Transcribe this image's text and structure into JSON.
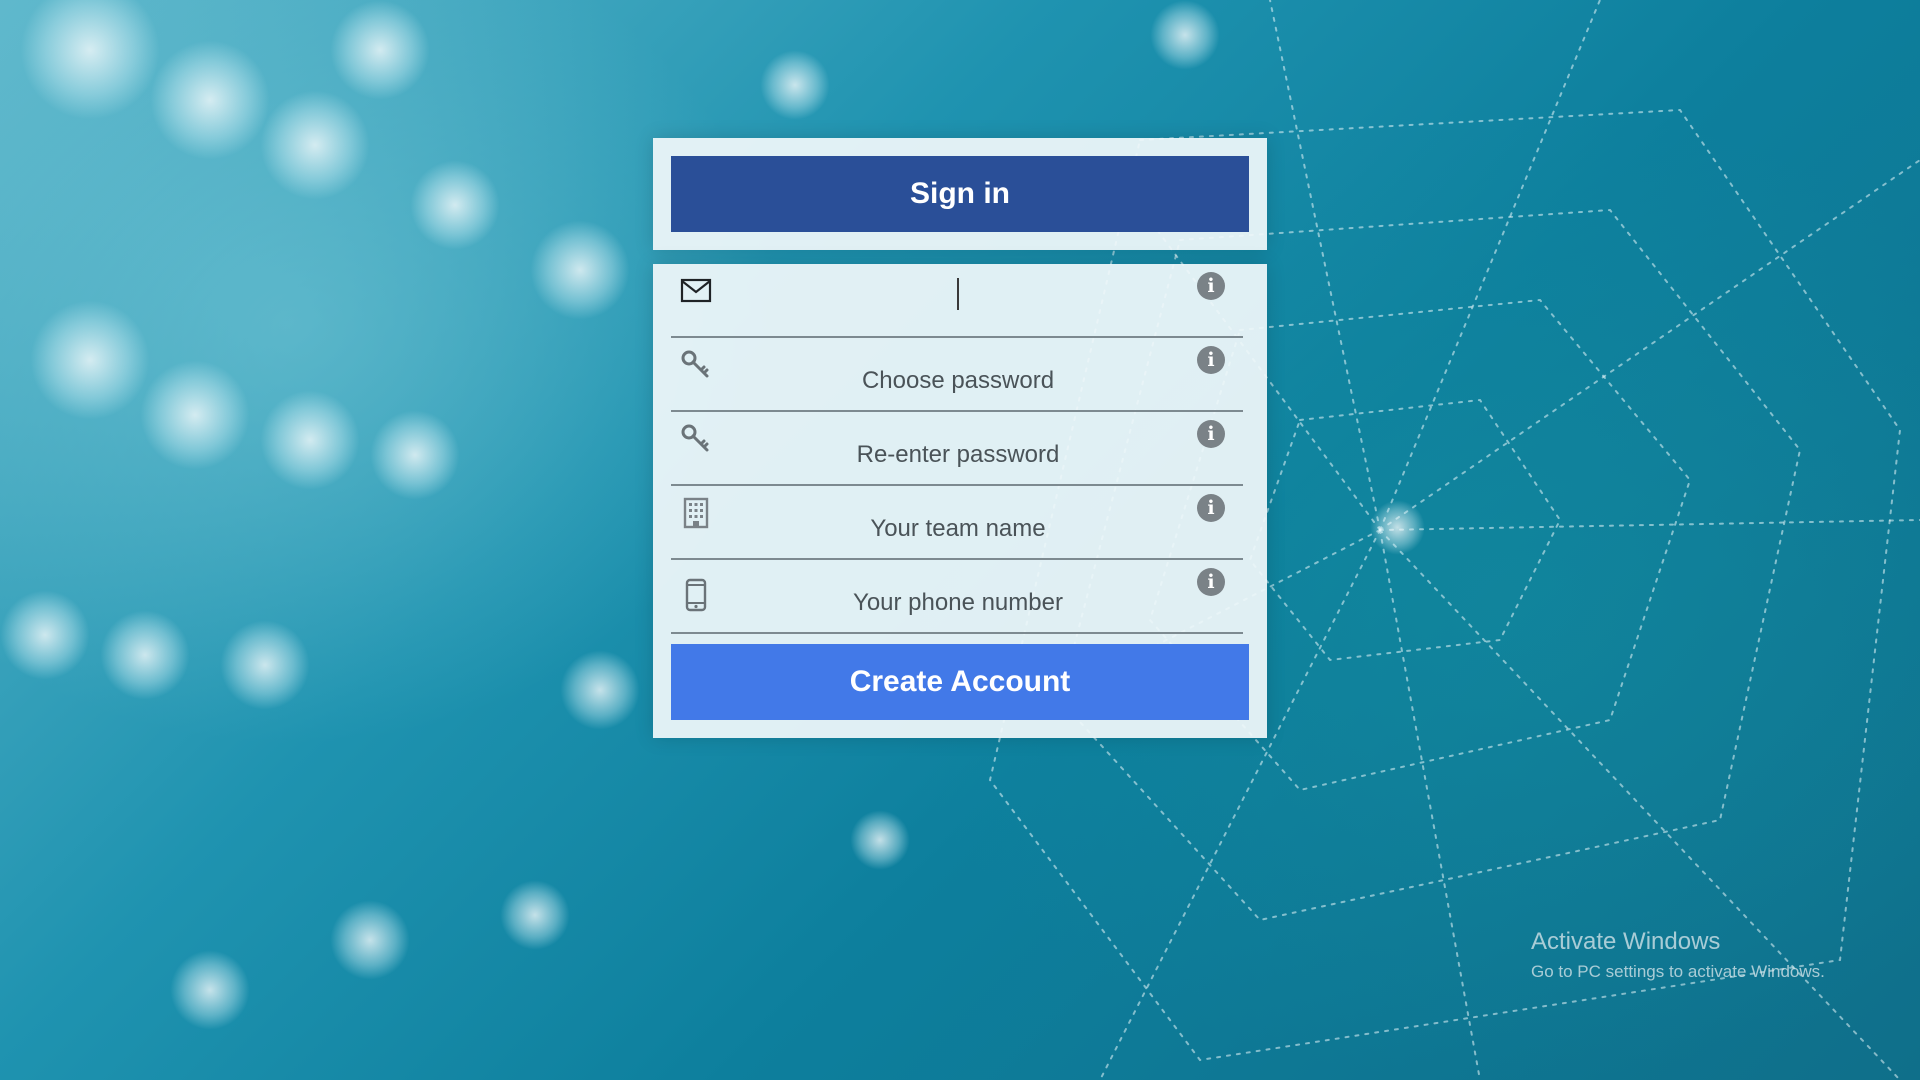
{
  "signin": {
    "label": "Sign in",
    "color": "#2a4f98"
  },
  "form": {
    "fields": [
      {
        "icon": "envelope-icon",
        "value": "",
        "placeholder": ""
      },
      {
        "icon": "key-icon",
        "value": "",
        "placeholder": "Choose password"
      },
      {
        "icon": "key-icon",
        "value": "",
        "placeholder": "Re-enter password"
      },
      {
        "icon": "building-icon",
        "value": "",
        "placeholder": "Your team name"
      },
      {
        "icon": "mobile-phone-icon",
        "value": "",
        "placeholder": "Your phone number"
      }
    ],
    "info_icon": "info-icon"
  },
  "create_account": {
    "label": "Create Account",
    "color": "#4279e8"
  },
  "watermark": {
    "title": "Activate Windows",
    "subtitle": "Go to PC settings to activate Windows."
  }
}
